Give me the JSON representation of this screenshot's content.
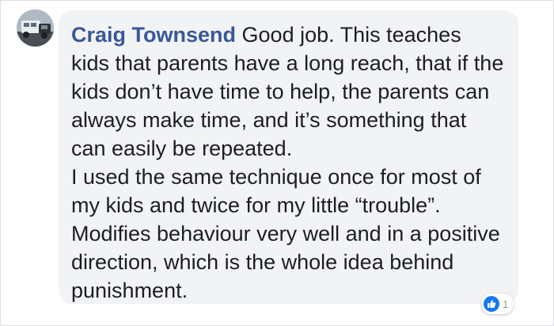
{
  "comment": {
    "author": "Craig Townsend",
    "first_paragraph": "Good job. This teaches kids that parents have a long reach, that if the kids don’t have time to help, the parents can always make time, and it’s something that can easily be repeated.",
    "second_paragraph": "I used the same technique once for most of my kids and twice for my little “trouble”. Modifies behaviour very well and in a positive direction, which is the whole idea behind punishment."
  },
  "reactions": {
    "icon": "like-icon",
    "count": "1"
  },
  "colors": {
    "author": "#385898",
    "bubble": "#f2f3f5",
    "like": "#1877f2"
  }
}
